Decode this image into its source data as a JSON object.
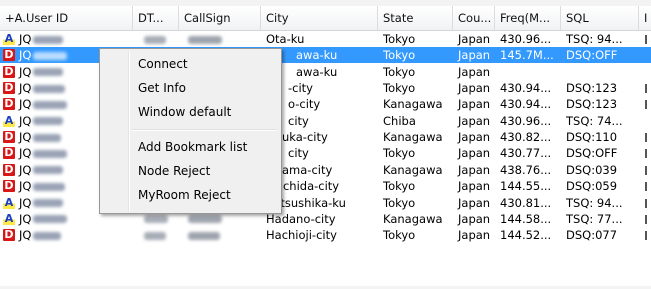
{
  "columns": [
    {
      "key": "user",
      "label": "+A.User ID"
    },
    {
      "key": "dt",
      "label": "DT..."
    },
    {
      "key": "call",
      "label": "CallSign"
    },
    {
      "key": "city",
      "label": "City"
    },
    {
      "key": "state",
      "label": "State"
    },
    {
      "key": "country",
      "label": "Cou..."
    },
    {
      "key": "freq",
      "label": "Freq(M..."
    },
    {
      "key": "sql",
      "label": "SQL"
    },
    {
      "key": "last",
      "label": "I"
    }
  ],
  "rows": [
    {
      "badge": "A",
      "user": "JQ",
      "city": "Ota-ku",
      "state": "Tokyo",
      "country": "Japan",
      "freq": "430.96...",
      "sql": "TSQ: 94...",
      "last": true,
      "selected": false
    },
    {
      "badge": "D",
      "user": "JQ",
      "city": "awa-ku",
      "state": "Tokyo",
      "country": "Japan",
      "freq": "145.7M...",
      "sql": "DSQ:OFF",
      "last": false,
      "selected": true
    },
    {
      "badge": "D",
      "user": "JQ",
      "city": "awa-ku",
      "state": "Tokyo",
      "country": "Japan",
      "freq": "",
      "sql": "",
      "last": false,
      "selected": false
    },
    {
      "badge": "D",
      "user": "JQ",
      "city": "-city",
      "state": "Tokyo",
      "country": "Japan",
      "freq": "430.94...",
      "sql": "DSQ:123",
      "last": true,
      "selected": false
    },
    {
      "badge": "D",
      "user": "JQ",
      "city": "o-city",
      "state": "Kanagawa",
      "country": "Japan",
      "freq": "430.94...",
      "sql": "DSQ:123",
      "last": true,
      "selected": false
    },
    {
      "badge": "A",
      "user": "JQ",
      "city": "city",
      "state": "Chiba",
      "country": "Japan",
      "freq": "430.96...",
      "sql": "TSQ: 74...",
      "last": false,
      "selected": false
    },
    {
      "badge": "D",
      "user": "JQ",
      "city": "uka-city",
      "state": "Kanagawa",
      "country": "Japan",
      "freq": "430.82...",
      "sql": "DSQ:110",
      "last": true,
      "selected": false
    },
    {
      "badge": "D",
      "user": "JQ",
      "city": "city",
      "state": "Tokyo",
      "country": "Japan",
      "freq": "430.77...",
      "sql": "DSQ:OFF",
      "last": true,
      "selected": false
    },
    {
      "badge": "D",
      "user": "JQ",
      "city": "ama-city",
      "state": "Kanagawa",
      "country": "Japan",
      "freq": "438.76...",
      "sql": "DSQ:039",
      "last": true,
      "selected": false
    },
    {
      "badge": "D",
      "user": "JQ",
      "city": "Machida-city",
      "state": "Tokyo",
      "country": "Japan",
      "freq": "144.55...",
      "sql": "DSQ:059",
      "last": true,
      "selected": false
    },
    {
      "badge": "A",
      "user": "JQ",
      "city": "Katsushika-ku",
      "state": "Tokyo",
      "country": "Japan",
      "freq": "430.81...",
      "sql": "TSQ: 94...",
      "last": true,
      "selected": false
    },
    {
      "badge": "A",
      "user": "JQ",
      "city": "Hadano-city",
      "state": "Kanagawa",
      "country": "Japan",
      "freq": "144.58...",
      "sql": "TSQ: 77...",
      "last": true,
      "selected": false
    },
    {
      "badge": "D",
      "user": "JQ",
      "city": "Hachioji-city",
      "state": "Tokyo",
      "country": "Japan",
      "freq": "144.52...",
      "sql": "DSQ:077",
      "last": true,
      "selected": false
    }
  ],
  "context_menu": {
    "items": [
      {
        "label": "Connect"
      },
      {
        "label": "Get Info"
      },
      {
        "label": "Window default"
      },
      {
        "label": "Add Bookmark list"
      },
      {
        "label": "Node Reject"
      },
      {
        "label": "MyRoom Reject"
      }
    ]
  },
  "colors": {
    "selection": "#3399ff",
    "badge_A_text": "#1a3fc0",
    "badge_A_fill": "#ffe94a",
    "badge_D_fill": "#d81818",
    "menu_bg": "#f0f0f0"
  },
  "icons": {
    "badge_A": "analog-mode-icon",
    "badge_D": "digital-mode-icon"
  }
}
